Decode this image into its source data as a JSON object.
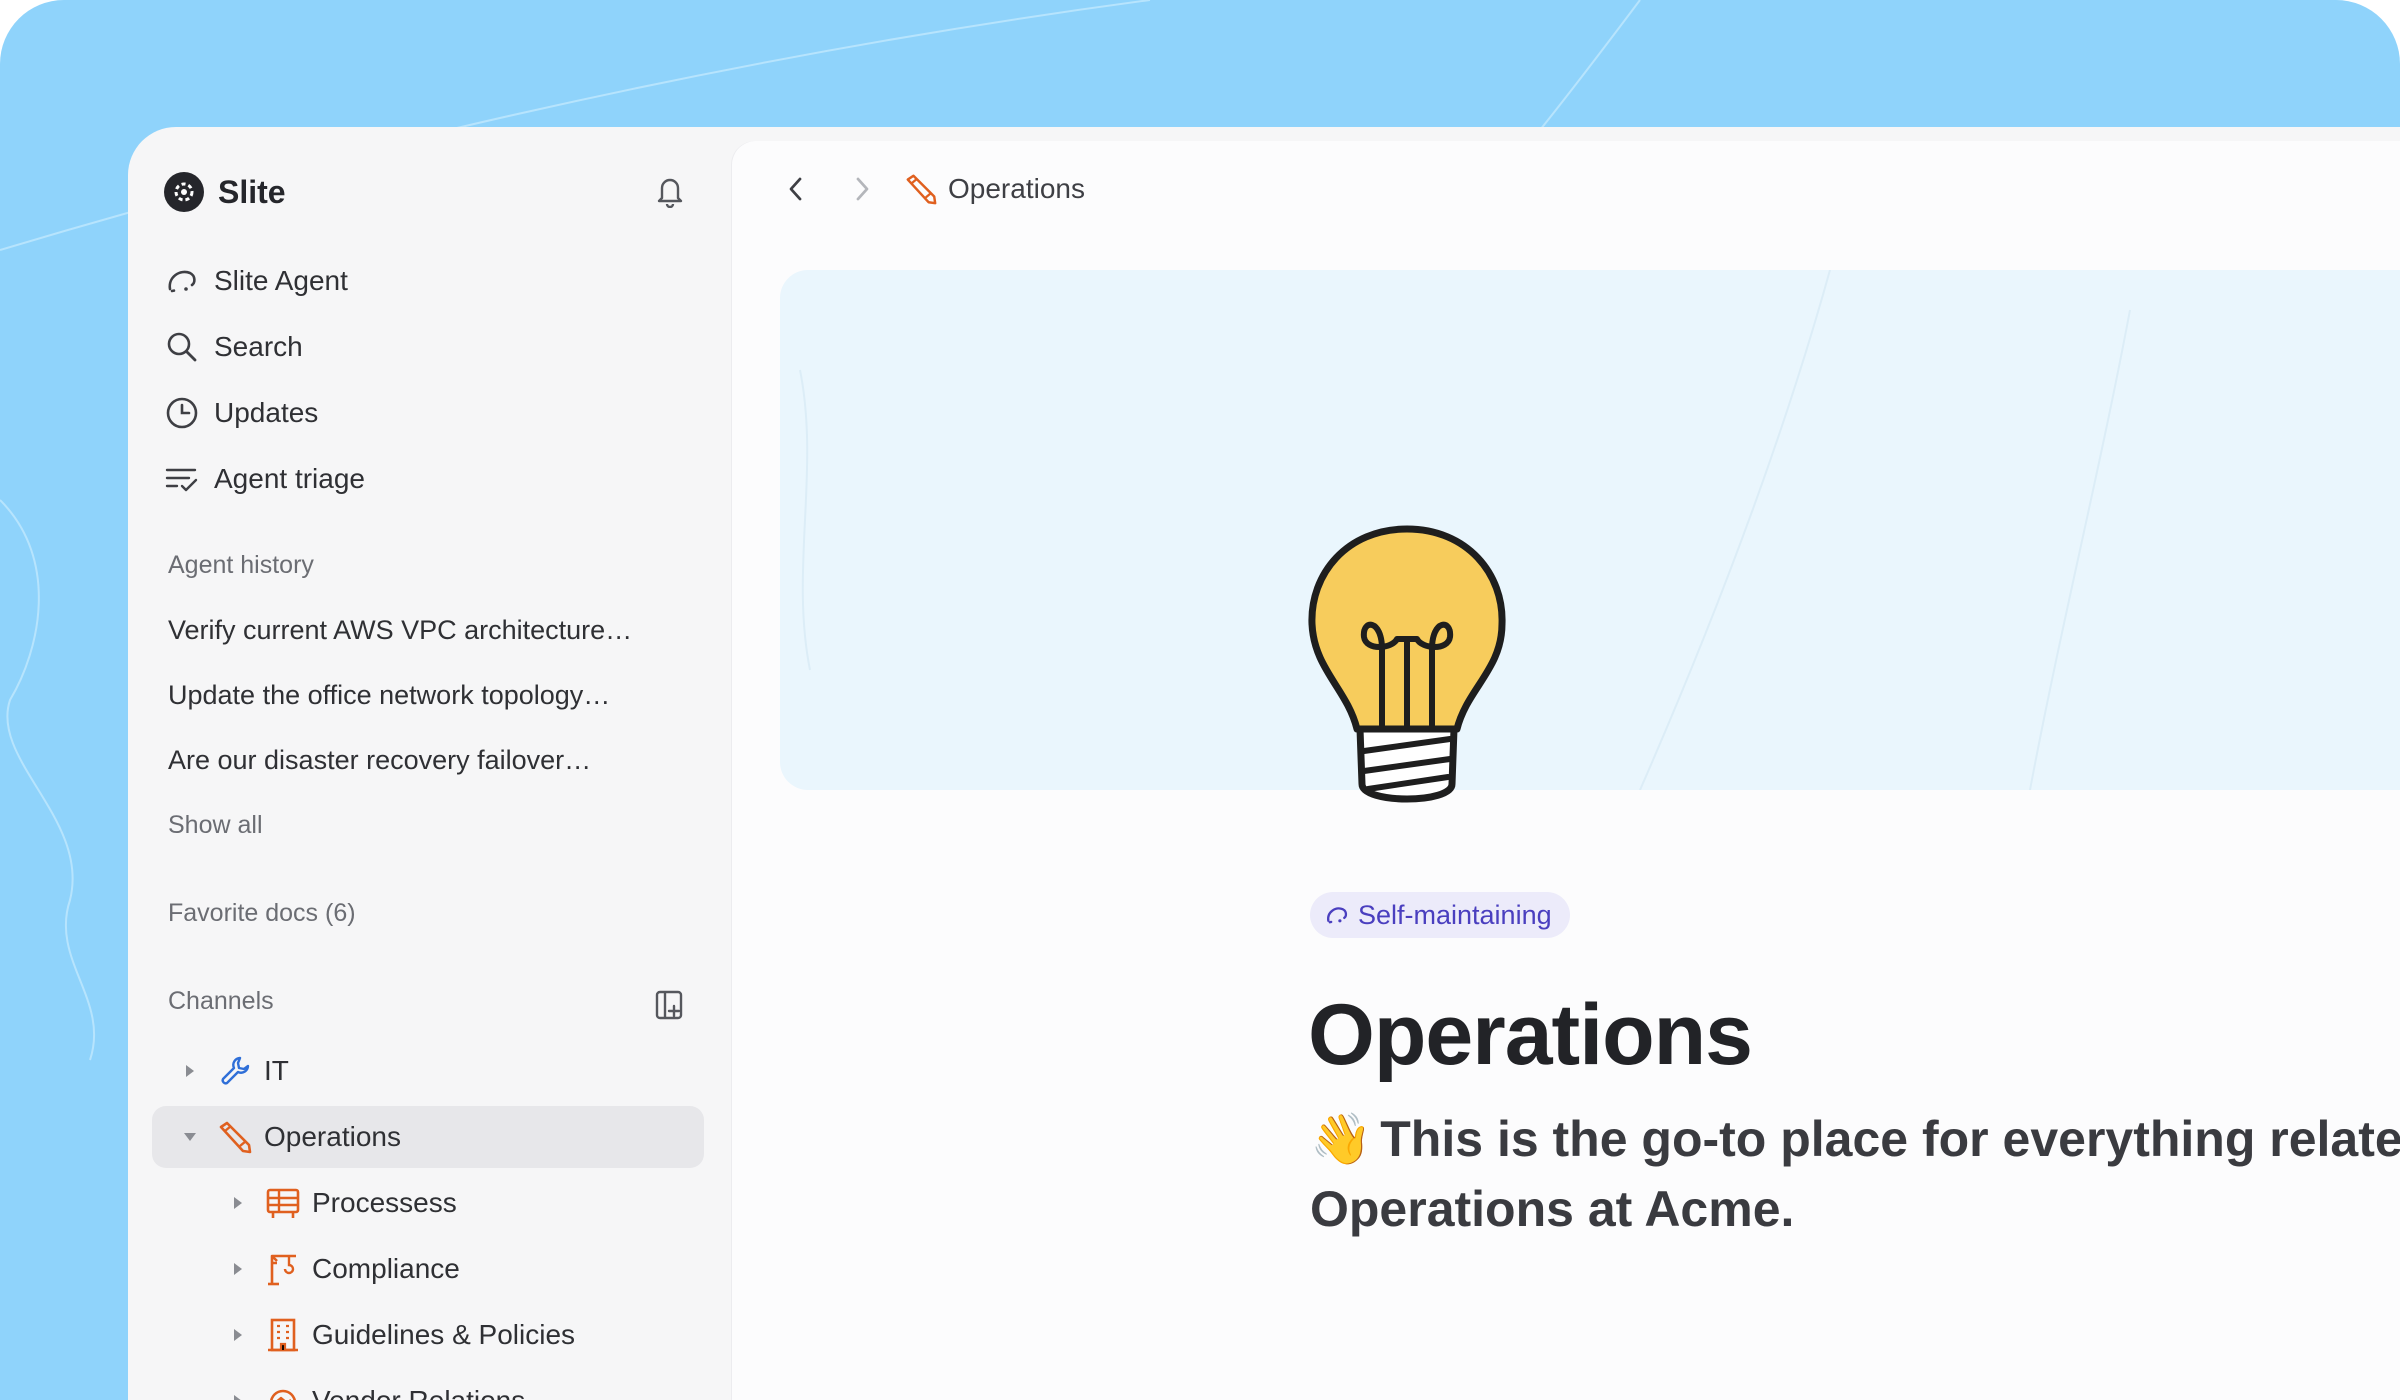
{
  "app": {
    "name": "Slite"
  },
  "sidebar": {
    "nav": [
      {
        "label": "Slite Agent",
        "icon": "agent-icon"
      },
      {
        "label": "Search",
        "icon": "search-icon"
      },
      {
        "label": "Updates",
        "icon": "clock-icon"
      },
      {
        "label": "Agent triage",
        "icon": "triage-icon"
      }
    ],
    "agent_history": {
      "title": "Agent history",
      "items": [
        "Verify current AWS VPC architecture…",
        "Update the office network topology…",
        "Are our disaster recovery failover…"
      ],
      "show_all": "Show all"
    },
    "favorites": {
      "title": "Favorite docs (6)"
    },
    "channels": {
      "title": "Channels",
      "items": [
        {
          "label": "IT",
          "icon": "wrench-icon",
          "expanded": false
        },
        {
          "label": "Operations",
          "icon": "pencil-icon",
          "expanded": true,
          "active": true
        },
        {
          "label": "Processess",
          "icon": "table-icon",
          "expanded": false
        },
        {
          "label": "Compliance",
          "icon": "crane-icon",
          "expanded": false
        },
        {
          "label": "Guidelines & Policies",
          "icon": "building-icon",
          "expanded": false
        },
        {
          "label": "Vendor Relations",
          "icon": "handshake-icon",
          "expanded": false
        }
      ]
    }
  },
  "main": {
    "breadcrumb": "Operations",
    "badge": "Self-maintaining",
    "title": "Operations",
    "subtitle_emoji": "👋",
    "subtitle": "This is the go-to place for everything related to Operations at Acme."
  },
  "colors": {
    "background": "#8fd3fb",
    "sidebar": "#f6f6f7",
    "accent_orange": "#e0601f",
    "badge_bg": "#ecebfa",
    "badge_text": "#4a3fbf",
    "bulb_yellow": "#f7cc5c"
  }
}
